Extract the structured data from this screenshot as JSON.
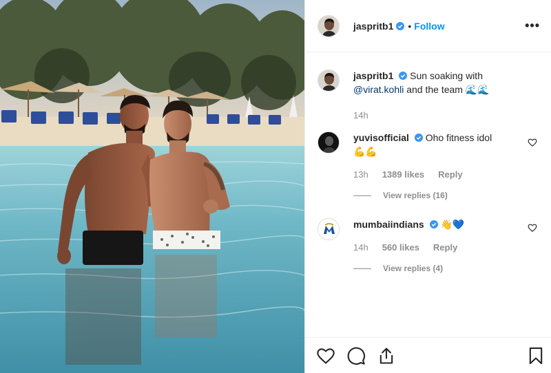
{
  "post": {
    "author": "jaspritb1",
    "follow_label": "Follow",
    "separator": "•",
    "more_label": "•••"
  },
  "caption": {
    "username": "jaspritb1",
    "text_before": "Sun soaking with",
    "mention": "@virat.kohli",
    "text_after": "and the team",
    "emoji": "🌊🌊",
    "time": "14h"
  },
  "comments": [
    {
      "username": "yuvisofficial",
      "text": "Oho fitness idol",
      "emoji_line": "💪💪",
      "time": "13h",
      "likes": "1389 likes",
      "reply_label": "Reply",
      "view_replies": "View replies (16)"
    },
    {
      "username": "mumbaiindians",
      "text": "",
      "emoji_line": "👋💙",
      "time": "14h",
      "likes": "560 likes",
      "reply_label": "Reply",
      "view_replies": "View replies (4)"
    }
  ],
  "icons": {
    "like": "heart-icon",
    "comment": "comment-icon",
    "share": "share-icon",
    "save": "bookmark-icon",
    "verified": "verified-badge-icon"
  },
  "colors": {
    "accent": "#0095f6",
    "verified": "#3897f0",
    "muted": "#8e8e8e",
    "mention": "#00376b"
  }
}
